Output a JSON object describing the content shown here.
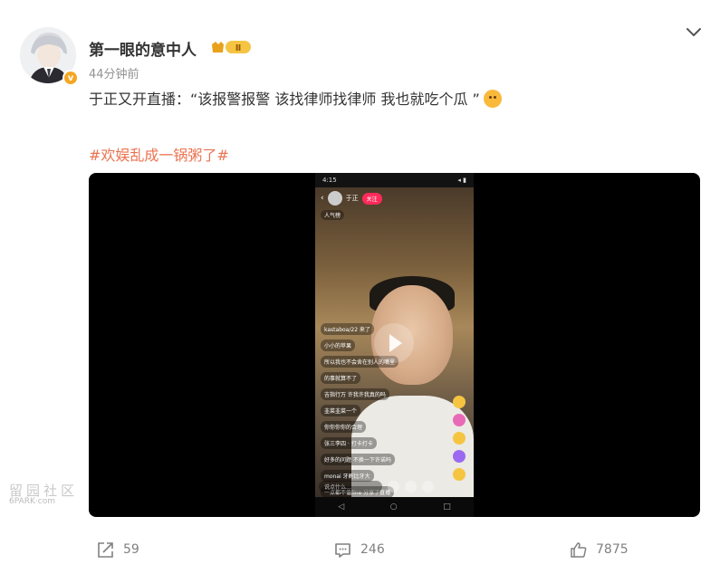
{
  "post": {
    "username": "第一眼的意中人",
    "level_badge": "Ⅱ",
    "verified_badge": "v",
    "timestamp": "44分钟前",
    "text": "于正又开直播：“该报警报警 该找律师找律师 我也就吃个瓜 ”",
    "emoji": "smirk-emoji",
    "hashtag": "#欢娱乱成一锅粥了#"
  },
  "video": {
    "status_time": "4:15",
    "status_right": "◂ ▮",
    "streamer_name": "于正",
    "follow_label": "关注",
    "hot_label": "人气榜",
    "comments": [
      "kastaboa/22 来了",
      "小小的苹果",
      "所以我也不会舍在别人的嘴里",
      "的事就算不了",
      "吉指行万 许我许我真的吗",
      "韭菜韭菜一个",
      "你你你你的合理",
      "张三李四 · 打卡打卡",
      "好多的问题 不换一下许诺吗",
      "monai 牙刷比牙大",
      "一点都不值fine 分享了直播"
    ],
    "input_placeholder": "说点什么…",
    "nav": [
      "◁",
      "○",
      "□"
    ]
  },
  "watermark": {
    "cn": "留园社区",
    "en": "6PARK·com"
  },
  "actions": {
    "forward_count": "59",
    "comment_count": "246",
    "like_count": "7875"
  },
  "colors": {
    "hashtag": "#eb7350",
    "verified": "#f5a623",
    "follow": "#ff2a5a"
  }
}
